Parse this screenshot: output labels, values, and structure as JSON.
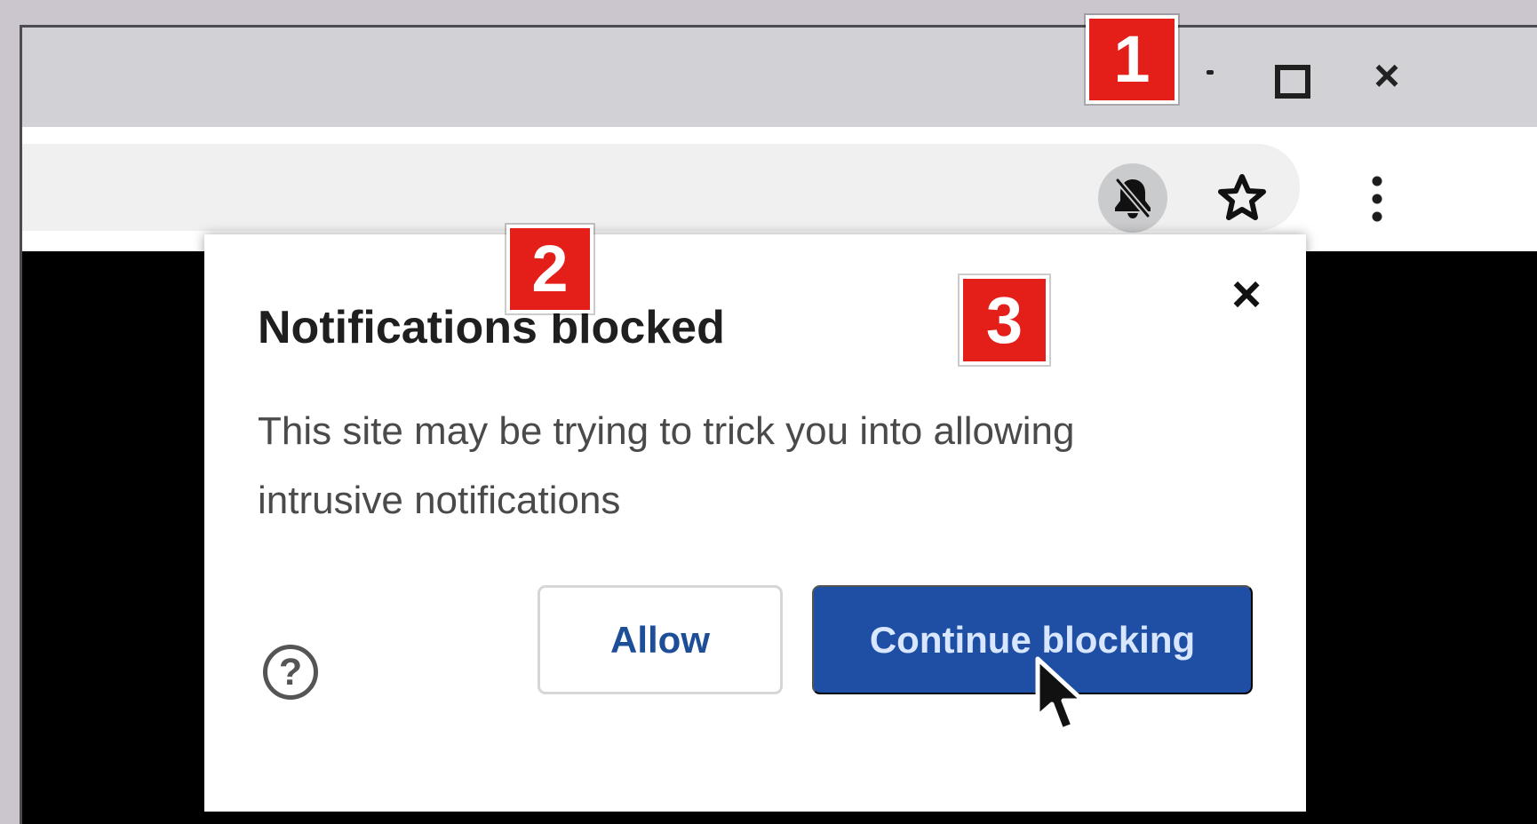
{
  "browser": {
    "toolbar": {
      "notification_icon": "notification-blocked-icon",
      "bookmark_icon": "star-icon",
      "more_icon": "vertical-dots-icon"
    },
    "window_controls": {
      "minimize_icon": "minimize-icon",
      "maximize_icon": "maximize-icon",
      "close_icon": "close-window-icon"
    }
  },
  "dialog": {
    "title": "Notifications blocked",
    "message": "This site may be trying to trick you into allowing intrusive notifications",
    "close_icon": "close-icon",
    "help_icon": "help-icon",
    "allow_label": "Allow",
    "continue_label": "Continue blocking"
  },
  "annotations": {
    "step_1": "1",
    "step_2": "2",
    "step_3": "3"
  },
  "colors": {
    "primary_blue": "#1f4fa5",
    "annotation_red": "#e41f19",
    "dialog_text": "#1f1f1f",
    "secondary_text": "#4a4a4a"
  }
}
